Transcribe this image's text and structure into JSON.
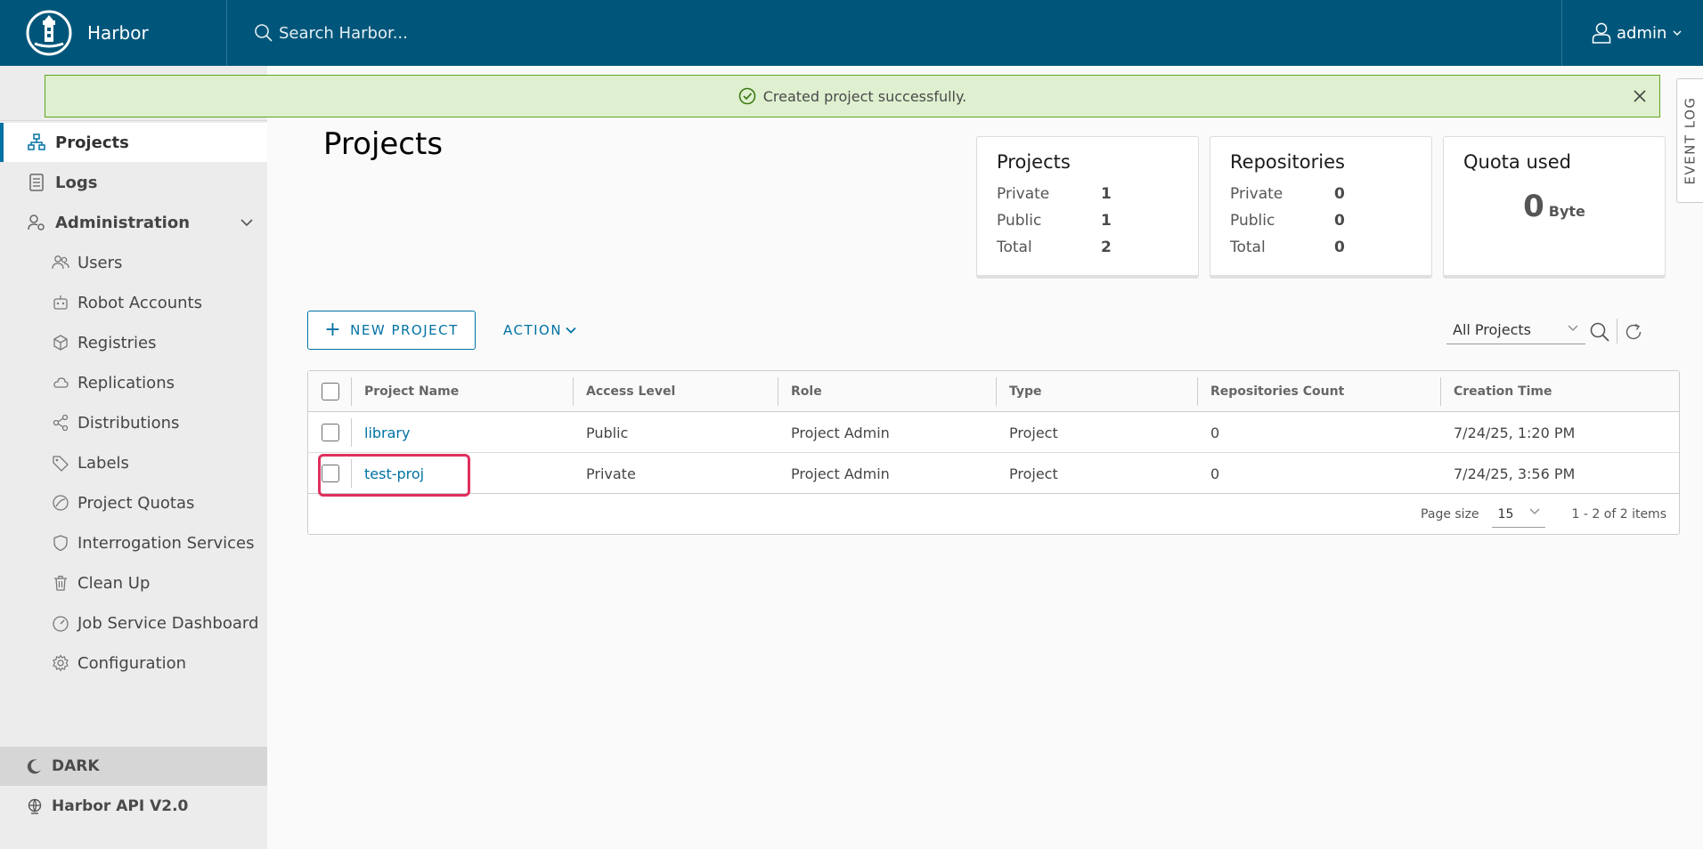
{
  "header": {
    "brand": "Harbor",
    "search_placeholder": "Search Harbor...",
    "user": "admin"
  },
  "alert": {
    "message": "Created project successfully.",
    "status_color": "#62a420"
  },
  "event_log": {
    "label": "EVENT LOG"
  },
  "sidebar": {
    "items": [
      {
        "label": "Projects",
        "icon": "projects-icon",
        "active": true
      },
      {
        "label": "Logs",
        "icon": "logs-icon"
      },
      {
        "label": "Administration",
        "icon": "administration-icon",
        "expanded": true
      }
    ],
    "admin_items": [
      {
        "label": "Users",
        "icon": "users-icon"
      },
      {
        "label": "Robot Accounts",
        "icon": "robot-icon"
      },
      {
        "label": "Registries",
        "icon": "registries-icon"
      },
      {
        "label": "Replications",
        "icon": "replications-icon"
      },
      {
        "label": "Distributions",
        "icon": "distributions-icon"
      },
      {
        "label": "Labels",
        "icon": "labels-icon"
      },
      {
        "label": "Project Quotas",
        "icon": "quotas-icon"
      },
      {
        "label": "Interrogation Services",
        "icon": "shield-icon"
      },
      {
        "label": "Clean Up",
        "icon": "trash-icon"
      },
      {
        "label": "Job Service Dashboard",
        "icon": "dashboard-icon"
      },
      {
        "label": "Configuration",
        "icon": "gear-icon"
      }
    ],
    "dark_label": "DARK",
    "api_label": "Harbor API V2.0"
  },
  "page": {
    "title": "Projects"
  },
  "cards": {
    "projects": {
      "title": "Projects",
      "rows": [
        {
          "label": "Private",
          "value": "1"
        },
        {
          "label": "Public",
          "value": "1"
        },
        {
          "label": "Total",
          "value": "2"
        }
      ]
    },
    "repositories": {
      "title": "Repositories",
      "rows": [
        {
          "label": "Private",
          "value": "0"
        },
        {
          "label": "Public",
          "value": "0"
        },
        {
          "label": "Total",
          "value": "0"
        }
      ]
    },
    "quota": {
      "title": "Quota used",
      "value": "0",
      "unit": "Byte"
    }
  },
  "toolbar": {
    "new_project": "NEW PROJECT",
    "action": "ACTION",
    "filter": "All Projects"
  },
  "table": {
    "columns": [
      "Project Name",
      "Access Level",
      "Role",
      "Type",
      "Repositories Count",
      "Creation Time"
    ],
    "rows": [
      [
        "library",
        "Public",
        "Project Admin",
        "Project",
        "0",
        "7/24/25, 1:20 PM"
      ],
      [
        "test-proj",
        "Private",
        "Project Admin",
        "Project",
        "0",
        "7/24/25, 3:56 PM"
      ]
    ],
    "highlighted_row": "test-proj",
    "highlight_color": "#e0305e",
    "footer": {
      "page_size_label": "Page size",
      "page_size": "15",
      "count": "1 - 2 of 2 items"
    }
  },
  "colors": {
    "header": "#00567a",
    "accent": "#0072a3"
  }
}
